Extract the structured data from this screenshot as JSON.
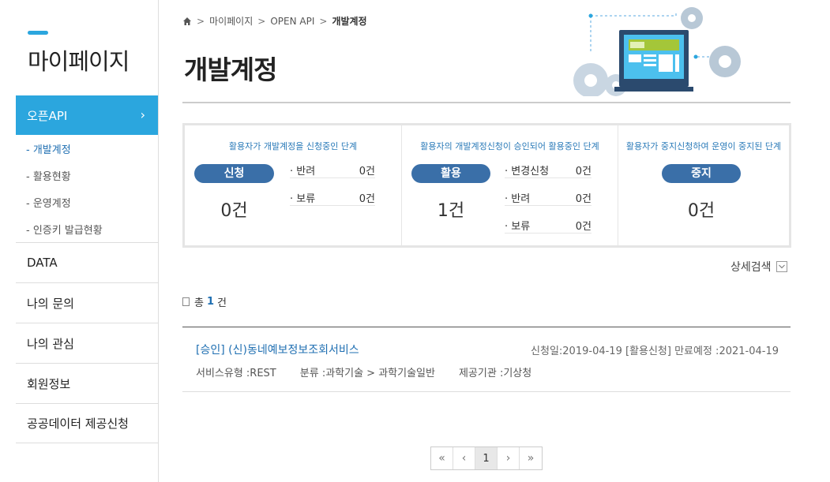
{
  "sidebar": {
    "title": "마이페이지",
    "active": {
      "label": "오픈API",
      "chevron": "›"
    },
    "subitems": [
      {
        "label": "- 개발계정"
      },
      {
        "label": "- 활용현황"
      },
      {
        "label": "- 운영계정"
      },
      {
        "label": "- 인증키 발급현황"
      }
    ],
    "items": [
      {
        "label": "DATA"
      },
      {
        "label": "나의 문의"
      },
      {
        "label": "나의 관심"
      },
      {
        "label": "회원정보"
      },
      {
        "label": "공공데이터 제공신청"
      }
    ]
  },
  "breadcrumb": {
    "home_icon": "home-icon",
    "sep": ">",
    "items": [
      "마이페이지",
      "OPEN API",
      "개발계정"
    ]
  },
  "page": {
    "title": "개발계정"
  },
  "status": {
    "apply": {
      "desc": "활용자가 개발계정을 신청중인 단계",
      "pill": "신청",
      "count": "0건",
      "rows": [
        {
          "key": "· 반려",
          "value": "0건"
        },
        {
          "key": "· 보류",
          "value": "0건"
        }
      ]
    },
    "use": {
      "desc": "활용자의 개발계정신청이 승인되어 활용중인 단계",
      "pill": "활용",
      "count": "1건",
      "rows": [
        {
          "key": "· 변경신청",
          "value": "0건"
        },
        {
          "key": "· 반려",
          "value": "0건"
        },
        {
          "key": "· 보류",
          "value": "0건"
        }
      ]
    },
    "stop": {
      "desc": "활용자가 중지신청하여 운영이 중지된 단계",
      "pill": "중지",
      "count": "0건"
    }
  },
  "detail_search": {
    "label": "상세검색",
    "icon": "chevron-down-icon"
  },
  "total": {
    "prefix": "총",
    "count": "1",
    "suffix": "건"
  },
  "list": [
    {
      "status": "[승인]",
      "title": "(신)동네예보정보조회서비스",
      "meta": "신청일:2019-04-19 [활용신청] 만료예정 :2021-04-19",
      "service_type": "서비스유형 :REST",
      "category": "분류 :과학기술 > 과학기술일반",
      "provider": "제공기관 :기상청"
    }
  ],
  "pager": {
    "first": "«",
    "prev": "‹",
    "current": "1",
    "next": "›",
    "last": "»"
  },
  "colors": {
    "accent": "#2ba6de",
    "pill": "#3a6fa8",
    "link": "#1f6fb2"
  }
}
